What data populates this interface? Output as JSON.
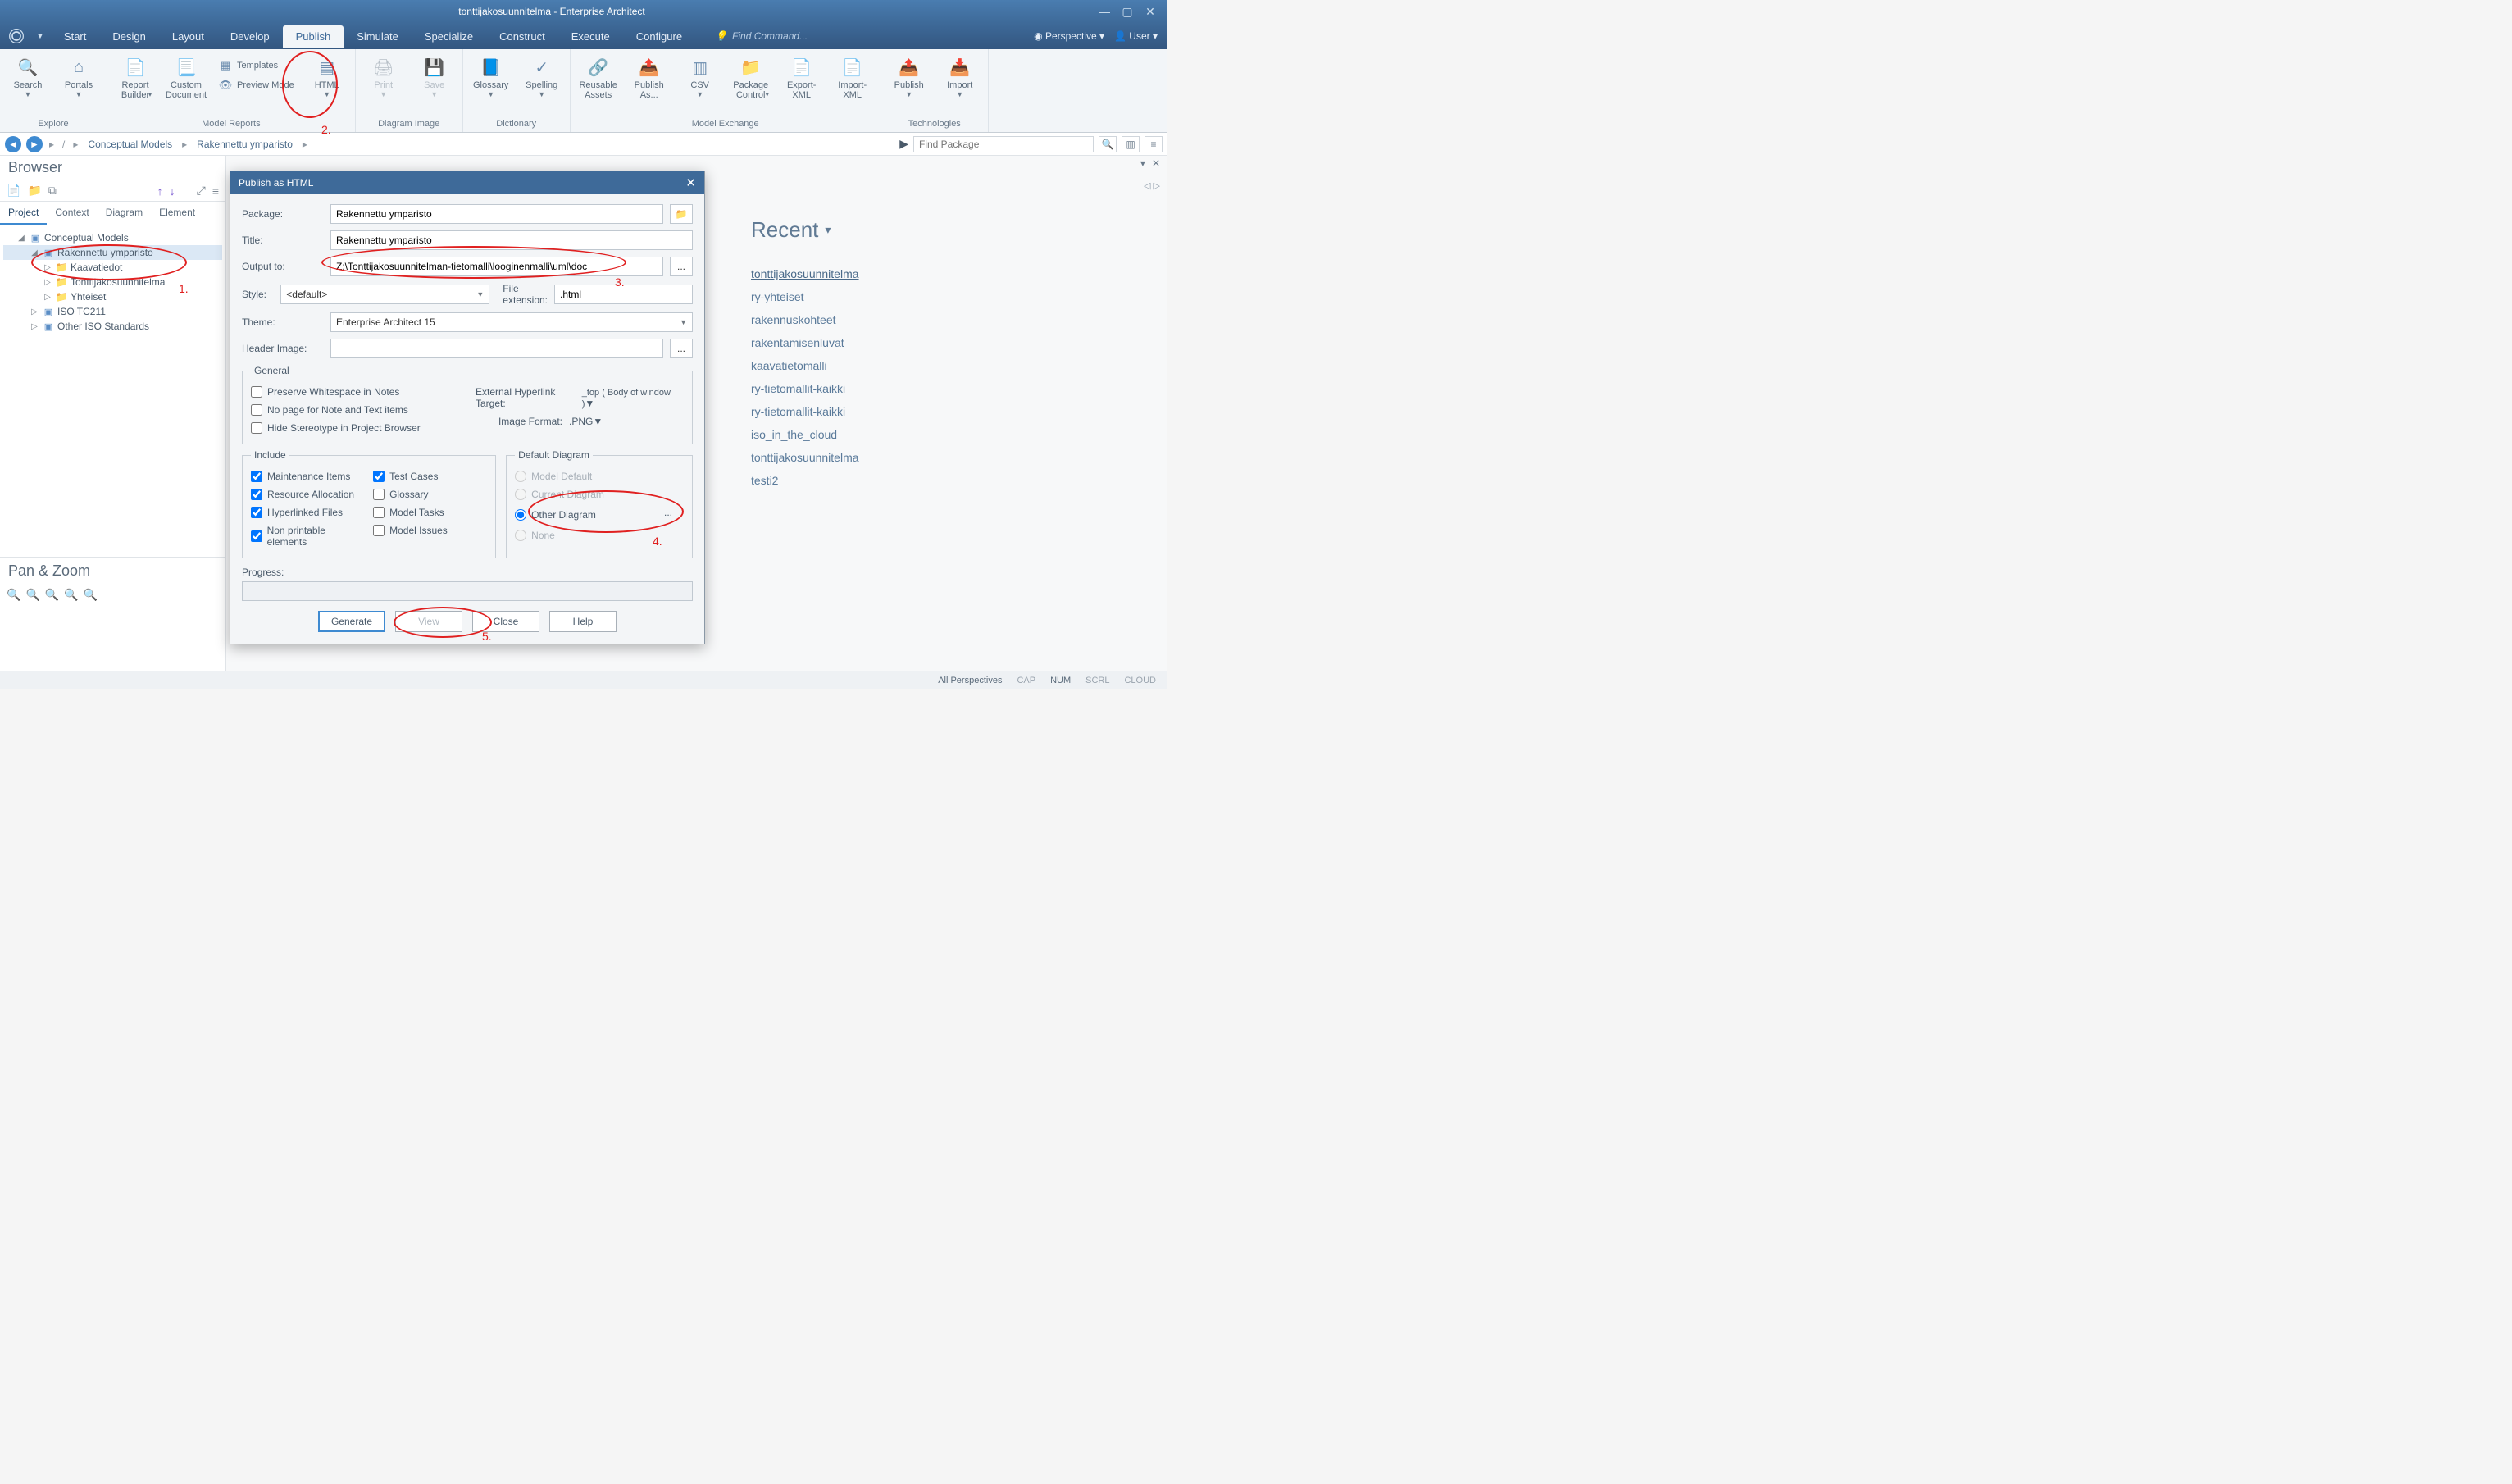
{
  "app_title": "tonttijakosuunnitelma - Enterprise Architect",
  "ribbon_tabs": [
    "Start",
    "Design",
    "Layout",
    "Develop",
    "Publish",
    "Simulate",
    "Specialize",
    "Construct",
    "Execute",
    "Configure"
  ],
  "ribbon_active": 4,
  "find_command_placeholder": "Find Command...",
  "perspective_label": "Perspective",
  "user_label": "User",
  "ribbon_groups": {
    "explore": {
      "label": "Explore",
      "search": "Search",
      "portals": "Portals"
    },
    "model_reports": {
      "label": "Model Reports",
      "report_builder": "Report Builder",
      "custom_doc": "Custom Document",
      "templates": "Templates",
      "preview_mode": "Preview Mode",
      "html": "HTML"
    },
    "diagram_image": {
      "label": "Diagram Image",
      "print": "Print",
      "save": "Save"
    },
    "dictionary": {
      "label": "Dictionary",
      "glossary": "Glossary",
      "spelling": "Spelling"
    },
    "model_exchange": {
      "label": "Model Exchange",
      "reusable": "Reusable Assets",
      "publish_as": "Publish As...",
      "csv": "CSV",
      "package_control": "Package Control",
      "export_xml": "Export-XML",
      "import_xml": "Import-XML"
    },
    "technologies": {
      "label": "Technologies",
      "publish": "Publish",
      "import": "Import"
    }
  },
  "breadcrumbs": [
    "Conceptual Models",
    "Rakennettu ymparisto"
  ],
  "find_package_placeholder": "Find Package",
  "browser": {
    "title": "Browser",
    "tabs": [
      "Project",
      "Context",
      "Diagram",
      "Element"
    ],
    "tree": {
      "root": "Conceptual Models",
      "selected": "Rakennettu ymparisto",
      "children": [
        "Kaavatiedot",
        "Tonttijakosuunnitelma",
        "Yhteiset"
      ],
      "siblings": [
        "ISO TC211",
        "Other ISO Standards"
      ]
    }
  },
  "pan_zoom_title": "Pan & Zoom",
  "recent": {
    "title": "Recent",
    "items": [
      "tonttijakosuunnitelma",
      "ry-yhteiset",
      "rakennuskohteet",
      "rakentamisenluvat",
      "kaavatietomalli",
      "ry-tietomallit-kaikki",
      "ry-tietomallit-kaikki",
      "iso_in_the_cloud",
      "tonttijakosuunnitelma",
      "testi2"
    ]
  },
  "statusbar": {
    "perspectives": "All Perspectives",
    "cap": "CAP",
    "num": "NUM",
    "scrl": "SCRL",
    "cloud": "CLOUD"
  },
  "dialog": {
    "title": "Publish as HTML",
    "labels": {
      "package": "Package:",
      "title": "Title:",
      "output_to": "Output to:",
      "style": "Style:",
      "file_ext": "File extension:",
      "theme": "Theme:",
      "header_image": "Header Image:",
      "progress": "Progress:",
      "general": "General",
      "include": "Include",
      "default_diagram": "Default Diagram",
      "ext_hyperlink": "External Hyperlink Target:",
      "image_format": "Image Format:"
    },
    "values": {
      "package": "Rakennettu ymparisto",
      "title_val": "Rakennettu ymparisto",
      "output_to": "Z:\\Tonttijakosuunnitelman-tietomalli\\looginenmalli\\uml\\doc",
      "style": "<default>",
      "file_ext": ".html",
      "theme": "Enterprise Architect 15",
      "header_image": "",
      "hyperlink_target": "_top  ( Body of window )",
      "image_format": ".PNG"
    },
    "general_checks": {
      "preserve_ws": "Preserve Whitespace in Notes",
      "no_page_note": "No page for Note and Text items",
      "hide_stereotype": "Hide Stereotype in Project Browser"
    },
    "include_checks": {
      "maintenance": "Maintenance Items",
      "resource": "Resource Allocation",
      "hyperlinked": "Hyperlinked Files",
      "nonprintable": "Non printable elements",
      "testcases": "Test Cases",
      "glossary": "Glossary",
      "modeltasks": "Model Tasks",
      "modelissues": "Model Issues"
    },
    "default_diagram": {
      "model_default": "Model Default",
      "current": "Current Diagram",
      "other": "Other Diagram",
      "none": "None"
    },
    "buttons": {
      "generate": "Generate",
      "view": "View",
      "close": "Close",
      "help": "Help"
    }
  },
  "annotations": {
    "1": "1.",
    "2": "2.",
    "3": "3.",
    "4": "4.",
    "5": "5."
  }
}
